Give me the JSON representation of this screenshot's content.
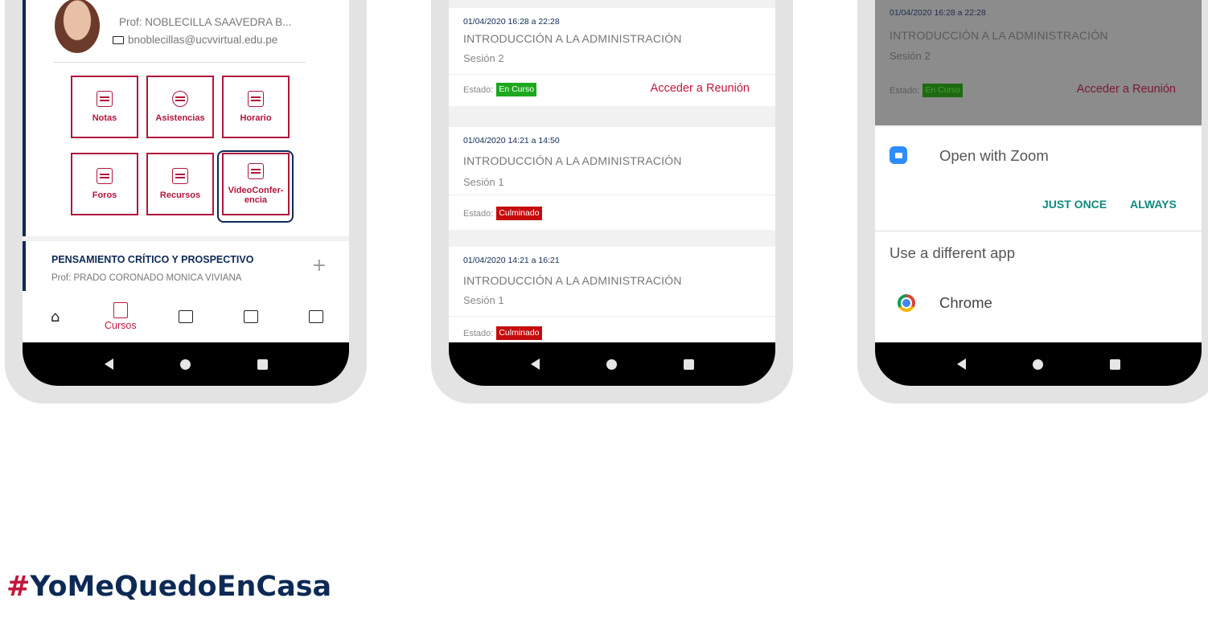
{
  "phone1": {
    "professor": "Prof: NOBLECILLA SAAVEDRA B...",
    "email": "bnoblecillas@ucvvirtual.edu.pe",
    "tiles": [
      "Notas",
      "Asistencias",
      "Horario",
      "Foros",
      "Recursos",
      "VideoConfer-encia"
    ],
    "course": {
      "title": "PENSAMIENTO CRÍTICO Y PROSPECTIVO",
      "professor": "Prof: PRADO CORONADO MONICA VIVIANA"
    },
    "bottom_nav": {
      "active_label": "Cursos"
    }
  },
  "phone2": {
    "sessions": [
      {
        "date": "01/04/2020 16:28 a 22:28",
        "title": "INTRODUCCIÓN A LA ADMINISTRACIÓN",
        "session": "Sesión 2",
        "state_label": "Estado:",
        "state": "En Curso",
        "action": "Acceder a Reunión"
      },
      {
        "date": "01/04/2020 14:21 a 14:50",
        "title": "INTRODUCCIÓN A LA ADMINISTRACIÓN",
        "session": "Sesión 1",
        "state_label": "Estado:",
        "state": "Culminado"
      },
      {
        "date": "01/04/2020 14:21 a 16:21",
        "title": "INTRODUCCIÓN A LA ADMINISTRACIÓN",
        "session": "Sesión 1",
        "state_label": "Estado:",
        "state": "Culminado"
      }
    ]
  },
  "phone3": {
    "session": {
      "date": "01/04/2020 16:28 a 22:28",
      "title": "INTRODUCCIÓN A LA ADMINISTRACIÓN",
      "session": "Sesión 2",
      "state_label": "Estado:",
      "state": "En Curso",
      "action": "Acceder a Reunión"
    },
    "chooser": {
      "open_with": "Open with Zoom",
      "just_once": "JUST ONCE",
      "always": "ALWAYS",
      "different_app": "Use a different app",
      "alt_app": "Chrome"
    }
  },
  "hashtag": {
    "mark": "#",
    "text": "YoMeQuedoEnCasa"
  },
  "colors": {
    "brand_red": "#c2173d",
    "navy": "#0d2a55",
    "badge_green": "#1da81d",
    "badge_red": "#c40c0c",
    "teal_button": "#0f8a7e"
  }
}
